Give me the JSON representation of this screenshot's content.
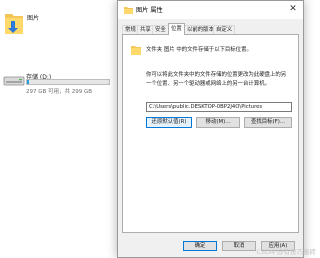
{
  "explorer": {
    "folder_label": "图片",
    "drive": {
      "label": "存储 (D:)",
      "free_text": "297 GB 可用，共 299 GB",
      "used_fraction": 0.02,
      "bar_color": "#26a0da"
    }
  },
  "dialog": {
    "title": "图片 属性",
    "close_glyph": "✕",
    "tabs": [
      "常规",
      "共享",
      "安全",
      "位置",
      "以前的版本",
      "自定义"
    ],
    "active_tab_index": 3,
    "location_line": "文件夹 图片 中的文件存储于以下目标位置。",
    "description": "你可以将此文件夹中的文件存储的位置更改为此硬盘上的另一个位置、另一个驱动器或网络上的另一台计算机。",
    "path_value": "C:\\Users\\public.DESKTOP-0BP2J4O\\Pictures",
    "buttons": {
      "restore": "还原默认值(R)",
      "move": "移动(M)...",
      "find_target": "查找目标(F)..."
    },
    "footer": {
      "ok": "确定",
      "cancel": "取消",
      "apply": "应用(A)"
    }
  },
  "watermark": "CSDN @有技巧搬砖"
}
